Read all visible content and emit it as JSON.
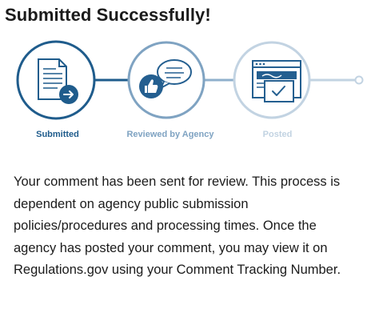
{
  "header": {
    "title": "Submitted Successfully!"
  },
  "steps": [
    {
      "label": "Submitted",
      "status": "complete",
      "icon": "document-send-icon",
      "color": "#1f5c8c"
    },
    {
      "label": "Reviewed by Agency",
      "status": "in-progress",
      "icon": "review-chat-icon",
      "color": "#7fa3c2"
    },
    {
      "label": "Posted",
      "status": "pending",
      "icon": "browser-posted-icon",
      "color": "#c2d3e2"
    }
  ],
  "message": {
    "body": "Your comment has been sent for review. This process is dependent on agency public submission policies/procedures and processing times. Once the agency has posted your comment, you may view it on Regulations.gov using your Comment Tracking Number."
  },
  "colors": {
    "step_complete": "#1f5c8c",
    "step_current": "#7fa3c2",
    "step_pending": "#c2d3e2",
    "thumb_fill": "#245f90",
    "text": "#1b1b1b"
  }
}
